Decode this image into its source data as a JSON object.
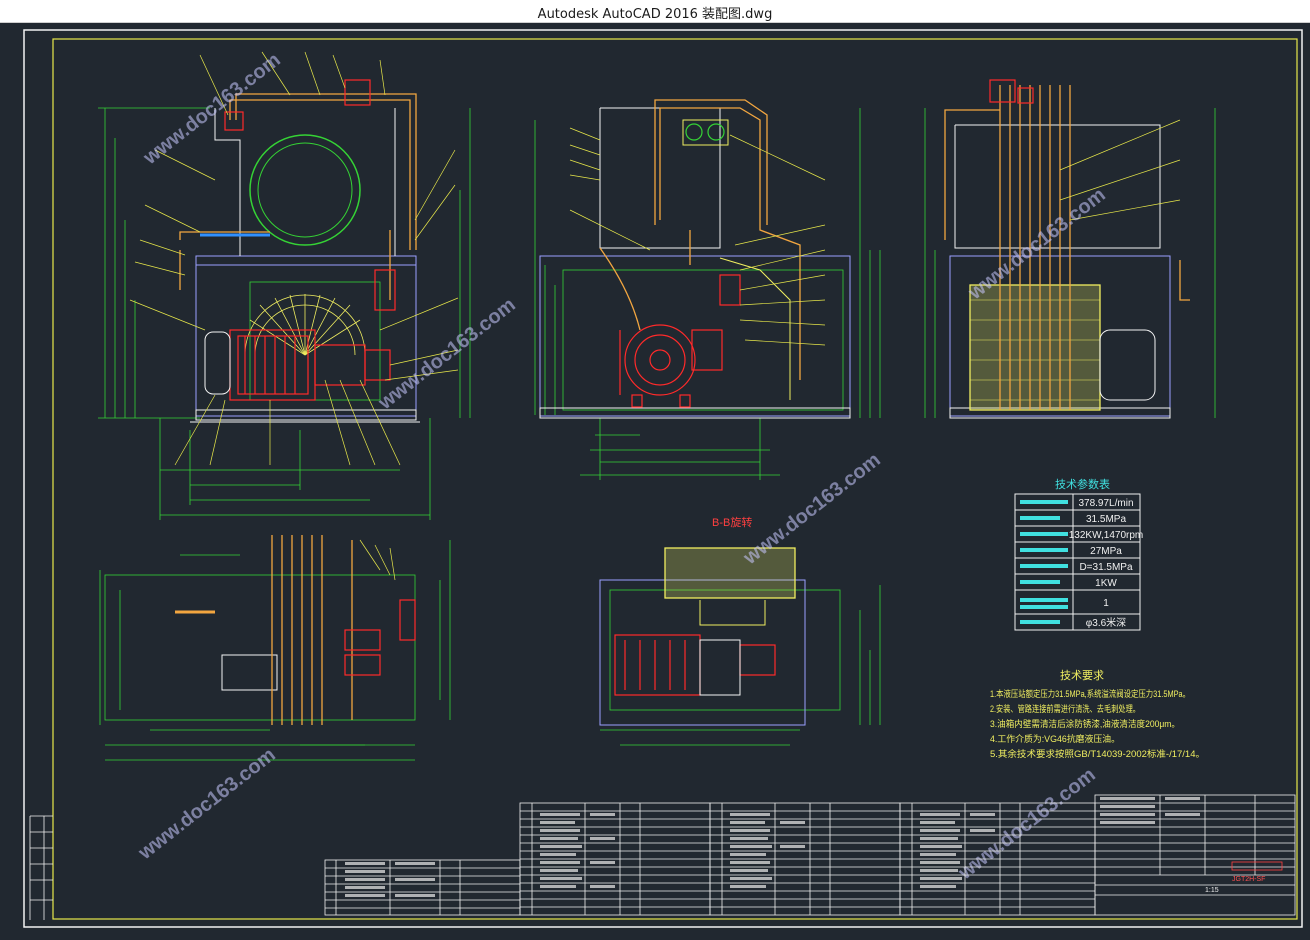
{
  "window": {
    "title": "Autodesk AutoCAD 2016    装配图.dwg"
  },
  "watermark": {
    "text": "www.doc163.com"
  },
  "section_label": "B-B旋转",
  "tech_params": {
    "title": "技术参数表",
    "values": [
      "378.97L/min",
      "31.5MPa",
      "132KW,1470rpm",
      "27MPa",
      "D=31.5MPa",
      "1KW",
      "1",
      "φ3.6米深"
    ]
  },
  "tech_requirements": {
    "title": "技术要求",
    "items": [
      "1.本液压站额定压力31.5MPa,系统溢流阀设定压力31.5MPa。",
      "2.安装、管路连接前需进行清洗、去毛刺处理。",
      "3.油箱内壁需清洁后涂防锈漆,油液清洁度200μm。",
      "4.工作介质为:VG46抗磨液压油。",
      "5.其余技术要求按照GB/T14039-2002标准-/17/14。"
    ]
  },
  "title_block": {
    "drawing_no": "JGT2H-SF",
    "scale": "1:15"
  },
  "colors": {
    "background": "#212830",
    "frame": "#f3f3f3",
    "inner_frame": "#e8e84a",
    "leader": "#e8e84a",
    "pump": "#ff2a2a",
    "pipe": "#f2a640",
    "dim": "#35d335",
    "table": "#f0f0f0",
    "text_yellow": "#f0ee60",
    "text_cyan": "#40e0e0"
  }
}
